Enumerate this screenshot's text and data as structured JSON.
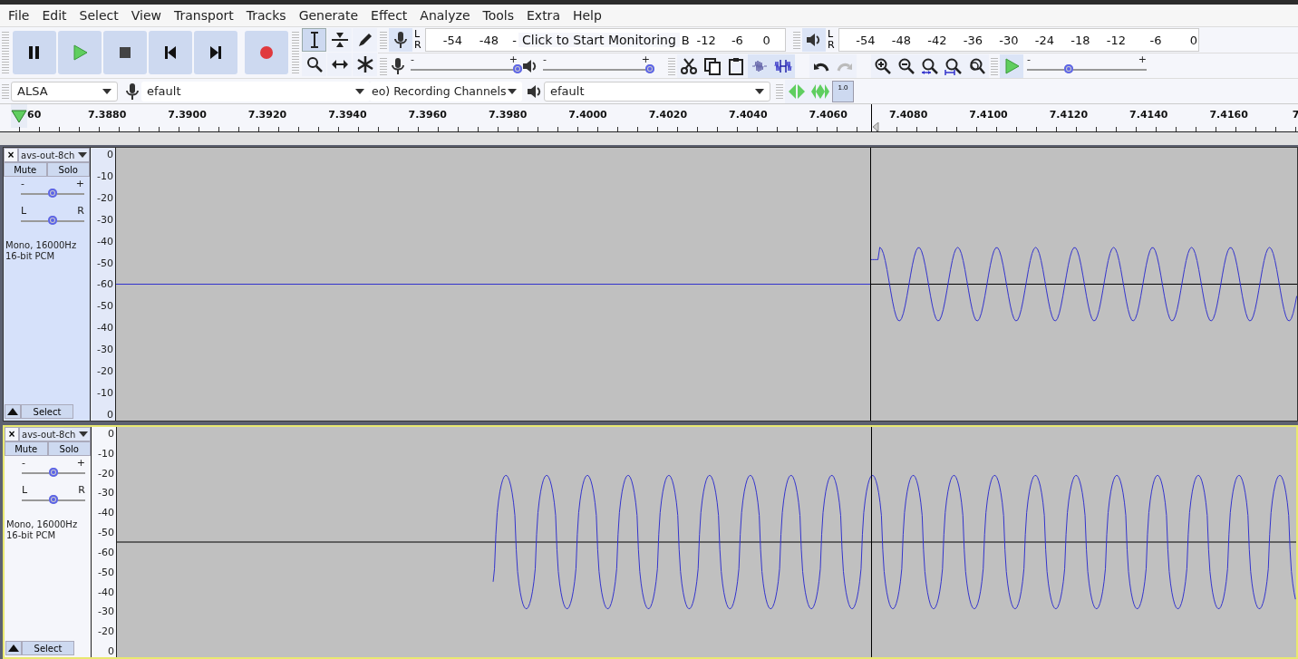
{
  "menu": [
    "File",
    "Edit",
    "Select",
    "View",
    "Transport",
    "Tracks",
    "Generate",
    "Effect",
    "Analyze",
    "Tools",
    "Extra",
    "Help"
  ],
  "transport": [
    {
      "kind": "pause"
    },
    {
      "kind": "play"
    },
    {
      "kind": "stop"
    },
    {
      "kind": "skip_start"
    },
    {
      "kind": "skip_end"
    },
    {
      "kind": "record"
    }
  ],
  "tools": [
    {
      "kind": "select",
      "selected": true
    },
    {
      "kind": "envelope",
      "selected": false
    },
    {
      "kind": "draw",
      "selected": false
    },
    {
      "kind": "zoom",
      "selected": false
    },
    {
      "kind": "timeshift",
      "selected": false
    },
    {
      "kind": "multi",
      "selected": false
    }
  ],
  "record_meter": {
    "channels": [
      "L",
      "R"
    ],
    "ticks": [
      "-54",
      "-48",
      "-"
    ],
    "monitor_hint": "Click to Start Monitoring",
    "ticks_after": [
      "B",
      "-12",
      "-6",
      "0"
    ]
  },
  "play_meter": {
    "channels": [
      "L",
      "R"
    ],
    "ticks": [
      "-54",
      "-48",
      "-42",
      "-36",
      "-30",
      "-24",
      "-18",
      "-12",
      "-6",
      "0"
    ]
  },
  "mixer": {
    "record": {
      "level": 1.0
    },
    "playback": {
      "level": 1.0
    },
    "min_label": "-",
    "max_label": "+"
  },
  "edit": [
    {
      "kind": "cut"
    },
    {
      "kind": "copy"
    },
    {
      "kind": "paste"
    },
    {
      "kind": "trim"
    },
    {
      "kind": "silence"
    }
  ],
  "history": [
    {
      "kind": "undo",
      "disabled": false
    },
    {
      "kind": "redo",
      "disabled": true
    }
  ],
  "zoom": [
    {
      "kind": "zoom_in"
    },
    {
      "kind": "zoom_out"
    },
    {
      "kind": "fit_selection"
    },
    {
      "kind": "fit_project"
    },
    {
      "kind": "zoom_toggle"
    }
  ],
  "play_at_speed": {
    "level": 0.35,
    "min_label": "-",
    "max_label": "+"
  },
  "devices": {
    "host": "ALSA",
    "recording_device": "efault",
    "channels": "eo) Recording Channels",
    "playback_device": "efault"
  },
  "scrub": {
    "speed_label": "1.0"
  },
  "ruler": {
    "labels": [
      "60",
      "7.3880",
      "7.3900",
      "7.3920",
      "7.3940",
      "7.3960",
      "7.3980",
      "7.4000",
      "7.4020",
      "7.4040",
      "7.4060",
      "7.4080",
      "7.4100",
      "7.4120",
      "7.4140",
      "7.4160",
      "7"
    ]
  },
  "tracks": [
    {
      "close": "×",
      "name": "avs-out-8ch",
      "selected": true,
      "mute": "Mute",
      "solo": "Solo",
      "gain": {
        "level": 0.5,
        "min_label": "-",
        "max_label": "+"
      },
      "pan": {
        "level": 0.5,
        "left": "L",
        "right": "R"
      },
      "format": [
        "Mono, 16000Hz",
        "16-bit PCM"
      ],
      "select_label": "Select",
      "scale": [
        "0",
        "-10",
        "-20",
        "-30",
        "-40",
        "-50",
        "-60",
        "-50",
        "-40",
        "-30",
        "-20",
        "-10",
        "0"
      ]
    },
    {
      "close": "×",
      "name": "avs-out-8ch",
      "selected": false,
      "mute": "Mute",
      "solo": "Solo",
      "gain": {
        "level": 0.5,
        "min_label": "-",
        "max_label": "+"
      },
      "pan": {
        "level": 0.5,
        "left": "L",
        "right": "R"
      },
      "format": [
        "Mono, 16000Hz",
        "16-bit PCM"
      ],
      "select_label": "Select",
      "scale": [
        "0",
        "-10",
        "-20",
        "-30",
        "-40",
        "-50",
        "-60",
        "-50",
        "-40",
        "-30",
        "-20",
        "0"
      ]
    }
  ]
}
